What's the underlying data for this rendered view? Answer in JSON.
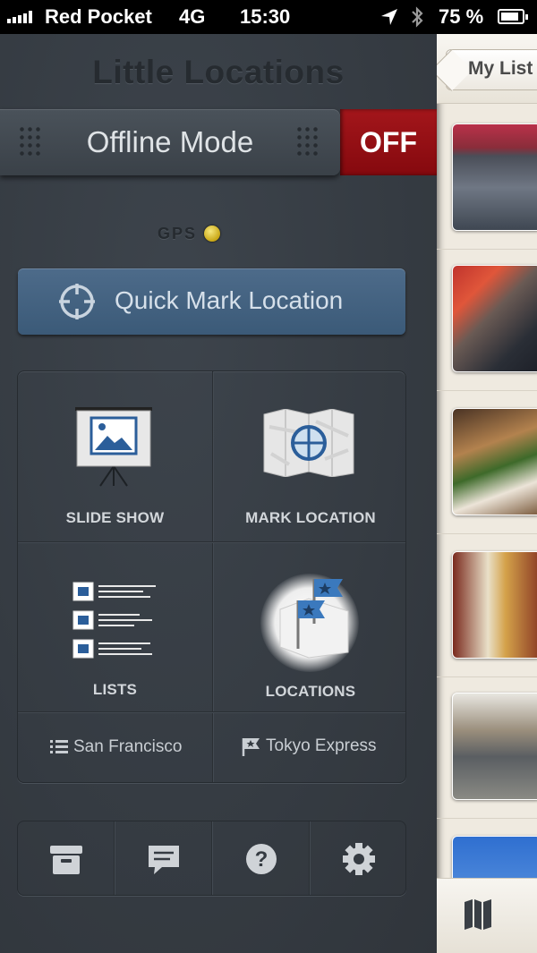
{
  "status_bar": {
    "carrier": "Red Pocket",
    "network": "4G",
    "time": "15:30",
    "battery": "75 %"
  },
  "panel": {
    "title": "Little Locations",
    "offline_mode": {
      "label": "Offline Mode",
      "state": "OFF"
    },
    "gps_label": "GPS",
    "quick_mark_label": "Quick Mark Location",
    "tiles": [
      {
        "label": "SLIDE SHOW",
        "icon": "slideshow-icon"
      },
      {
        "label": "MARK LOCATION",
        "icon": "map-target-icon"
      },
      {
        "label": "LISTS",
        "icon": "lists-icon"
      },
      {
        "label": "LOCATIONS",
        "icon": "flags-map-icon"
      }
    ],
    "current_list": "San Francisco",
    "current_location": "Tokyo Express",
    "toolbar": [
      "archive-icon",
      "chat-icon",
      "help-icon",
      "settings-icon"
    ]
  },
  "list_view": {
    "back_label": "My List",
    "thumbnails": [
      "restaurant-exterior",
      "open-sign-vendor",
      "sandwich",
      "corona-beer",
      "street-view",
      "sky"
    ]
  },
  "colors": {
    "panel_bg": "#353b42",
    "toggle_red": "#a3161b",
    "quick_blue": "#45627f",
    "list_bg": "#efeae0"
  }
}
